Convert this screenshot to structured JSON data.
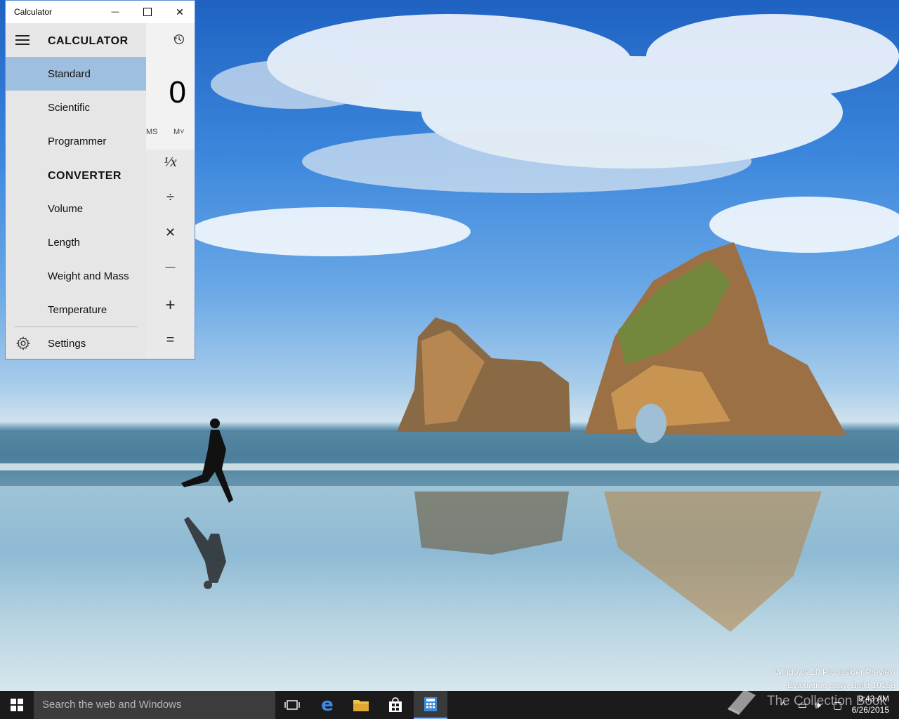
{
  "window": {
    "title": "Calculator",
    "minimize_glyph": "—",
    "maximize_glyph": "☐",
    "close_glyph": "✕"
  },
  "nav": {
    "calculator_header": "CALCULATOR",
    "converter_header": "CONVERTER",
    "calculator_items": [
      "Standard",
      "Scientific",
      "Programmer"
    ],
    "converter_items": [
      "Volume",
      "Length",
      "Weight and Mass",
      "Temperature"
    ],
    "selected": "Standard",
    "settings_label": "Settings"
  },
  "display": {
    "value": "0",
    "memory_left": "MS",
    "memory_right": "M˅"
  },
  "operators": {
    "reciprocal": "¹∕x",
    "divide": "÷",
    "multiply": "✕",
    "subtract": "—",
    "add": "+",
    "equals": "="
  },
  "watermark": {
    "line1": "Windows 10 Pro Insider Preview",
    "line2": "Evaluation copy. Build 10158"
  },
  "taskbar": {
    "search_placeholder": "Search the web and Windows",
    "time": "9:43 AM",
    "date": "6/26/2015",
    "apps": [
      "task-view",
      "edge",
      "file-explorer",
      "store",
      "calculator"
    ],
    "active_app": "calculator"
  },
  "overlay_watermark": "The Collection Book",
  "colors": {
    "selected_nav": "#9fbfe0",
    "taskbar": "#1b1b1b",
    "accent": "#3a88d8"
  }
}
